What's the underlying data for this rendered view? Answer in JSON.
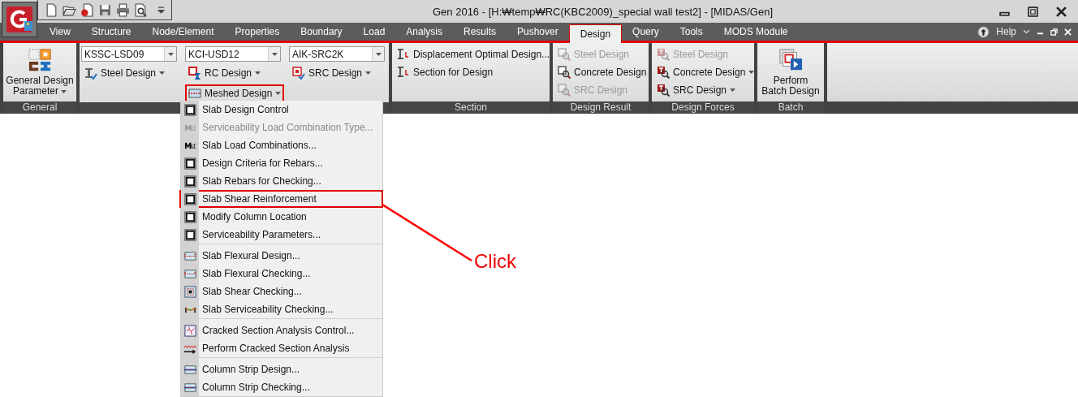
{
  "window": {
    "title": "Gen 2016 - [H:₩temp₩RC(KBC2009)_special wall test2] - [MIDAS/Gen]"
  },
  "tabs": [
    {
      "label": "View",
      "selected": false
    },
    {
      "label": "Structure",
      "selected": false
    },
    {
      "label": "Node/Element",
      "selected": false
    },
    {
      "label": "Properties",
      "selected": false
    },
    {
      "label": "Boundary",
      "selected": false
    },
    {
      "label": "Load",
      "selected": false
    },
    {
      "label": "Analysis",
      "selected": false
    },
    {
      "label": "Results",
      "selected": false
    },
    {
      "label": "Pushover",
      "selected": false
    },
    {
      "label": "Design",
      "selected": true
    },
    {
      "label": "Query",
      "selected": false
    },
    {
      "label": "Tools",
      "selected": false
    },
    {
      "label": "MODS Module",
      "selected": false
    }
  ],
  "help": {
    "label": "Help"
  },
  "ribbon": {
    "general": {
      "button": "General Design",
      "button_line2": "Parameter",
      "label": "General"
    },
    "codes": [
      {
        "code": "KSSC-LSD09",
        "button": "Steel Design",
        "kind": "steel",
        "highlighted": false
      },
      {
        "code": "KCI-USD12",
        "button": "RC Design",
        "kind": "rc",
        "highlighted": false
      },
      {
        "code": "AIK-SRC2K",
        "button": "SRC Design",
        "kind": "src",
        "highlighted": false
      }
    ],
    "meshed": {
      "label": "Meshed Design",
      "highlighted": true
    },
    "section": {
      "items": [
        "Displacement Optimal Design...",
        "Section for Design"
      ],
      "label": "Section"
    },
    "design_result": {
      "items": [
        {
          "label": "Steel Design",
          "disabled": true,
          "dropdown": false
        },
        {
          "label": "Concrete Design",
          "disabled": false,
          "dropdown": false
        },
        {
          "label": "SRC Design",
          "disabled": true,
          "dropdown": false
        }
      ],
      "label": "Design Result"
    },
    "design_forces": {
      "items": [
        {
          "label": "Steel Design",
          "disabled": true,
          "dropdown": false
        },
        {
          "label": "Concrete Design",
          "disabled": false,
          "dropdown": true
        },
        {
          "label": "SRC Design",
          "disabled": false,
          "dropdown": true
        }
      ],
      "label": "Design Forces"
    },
    "batch": {
      "button": "Perform",
      "button_line2": "Batch Design",
      "label": "Batch"
    }
  },
  "menu": [
    [
      {
        "label": "Slab Design Control",
        "kind": "grid",
        "disabled": false,
        "highlighted": false
      },
      {
        "label": "Serviceability Load Combination Type...",
        "kind": "mlc",
        "disabled": true,
        "highlighted": false
      },
      {
        "label": "Slab Load Combinations...",
        "kind": "mlc",
        "disabled": false,
        "highlighted": false
      },
      {
        "label": "Design Criteria for Rebars...",
        "kind": "grid",
        "disabled": false,
        "highlighted": false
      },
      {
        "label": "Slab Rebars for Checking...",
        "kind": "grid",
        "disabled": false,
        "highlighted": false
      },
      {
        "label": "Slab Shear Reinforcement",
        "kind": "grid",
        "disabled": false,
        "highlighted": true
      },
      {
        "label": "Modify Column Location",
        "kind": "grid",
        "disabled": false,
        "highlighted": false
      },
      {
        "label": "Serviceability Parameters...",
        "kind": "grid",
        "disabled": false,
        "highlighted": false
      }
    ],
    [
      {
        "label": "Slab Flexural Design...",
        "kind": "slab",
        "disabled": false,
        "highlighted": false
      },
      {
        "label": "Slab Flexural Checking...",
        "kind": "slab",
        "disabled": false,
        "highlighted": false
      },
      {
        "label": "Slab Shear Checking...",
        "kind": "shear",
        "disabled": false,
        "highlighted": false
      },
      {
        "label": "Slab Serviceability Checking...",
        "kind": "service",
        "disabled": false,
        "highlighted": false
      }
    ],
    [
      {
        "label": "Cracked Section Analysis Control...",
        "kind": "crack",
        "disabled": false,
        "highlighted": false
      },
      {
        "label": "Perform Cracked Section Analysis",
        "kind": "perform",
        "disabled": false,
        "highlighted": false
      }
    ],
    [
      {
        "label": "Column Strip Design...",
        "kind": "strip",
        "disabled": false,
        "highlighted": false
      },
      {
        "label": "Column Strip Checking...",
        "kind": "strip",
        "disabled": false,
        "highlighted": false
      }
    ]
  ],
  "callout": {
    "text": "Click"
  }
}
